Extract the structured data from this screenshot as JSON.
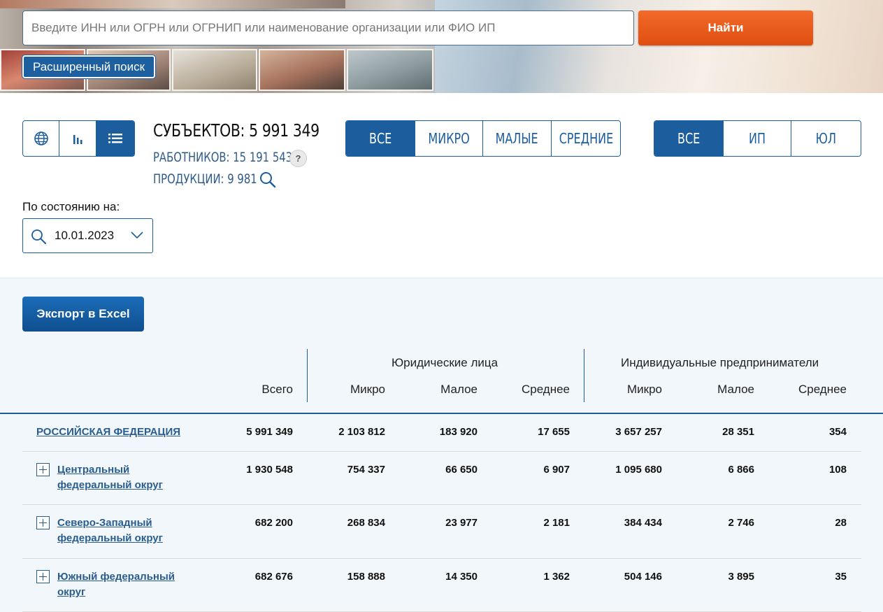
{
  "search": {
    "placeholder": "Введите ИНН или ОГРН или ОГРНИП или наименование организации или ФИО ИП",
    "find_label": "Найти",
    "advanced_label": "Расширенный поиск"
  },
  "view_toggle": {
    "icons": [
      "globe-icon",
      "bar-chart-icon",
      "list-icon"
    ],
    "active": "list"
  },
  "stats": {
    "subjects": "СУБЪЕКТОВ: 5 991 349",
    "workers": "РАБОТНИКОВ: 15 191 543",
    "help": "?",
    "products": "ПРОДУКЦИИ: 9 981"
  },
  "size_filter": {
    "options": [
      "ВСЕ",
      "МИКРО",
      "МАЛЫЕ",
      "СРЕДНИЕ"
    ],
    "active": "ВСЕ"
  },
  "type_filter": {
    "options": [
      "ВСЕ",
      "ИП",
      "ЮЛ"
    ],
    "active": "ВСЕ"
  },
  "date": {
    "label": "По состоянию на:",
    "value": "10.01.2023"
  },
  "export_label": "Экспорт в Excel",
  "table": {
    "group_legal": "Юридические лица",
    "group_ip": "Индивидуальные предприниматели",
    "columns": [
      "Всего",
      "Микро",
      "Малое",
      "Среднее",
      "Микро",
      "Малое",
      "Среднее"
    ],
    "rows": [
      {
        "name_lines": [
          "РОССИЙСКАЯ ФЕДЕРАЦИЯ"
        ],
        "values": [
          "5 991 349",
          "2 103 812",
          "183 920",
          "17 655",
          "3 657 257",
          "28 351",
          "354"
        ]
      },
      {
        "name_lines": [
          "Центральный",
          "федеральный округ"
        ],
        "values": [
          "1 930 548",
          "754 337",
          "66 650",
          "6 907",
          "1 095 680",
          "6 866",
          "108"
        ]
      },
      {
        "name_lines": [
          "Северо-Западный",
          "федеральный округ"
        ],
        "values": [
          "682 200",
          "268 834",
          "23 977",
          "2 181",
          "384 434",
          "2 746",
          "28"
        ]
      },
      {
        "name_lines": [
          "Южный федеральный",
          "округ"
        ],
        "values": [
          "682 676",
          "158 888",
          "14 350",
          "1 362",
          "504 146",
          "3 895",
          "35"
        ]
      }
    ]
  },
  "colors": {
    "primary": "#1c5d9e",
    "accent": "#e9541a",
    "link": "#2a5d8f",
    "panel_bg": "#f2f7fb"
  }
}
